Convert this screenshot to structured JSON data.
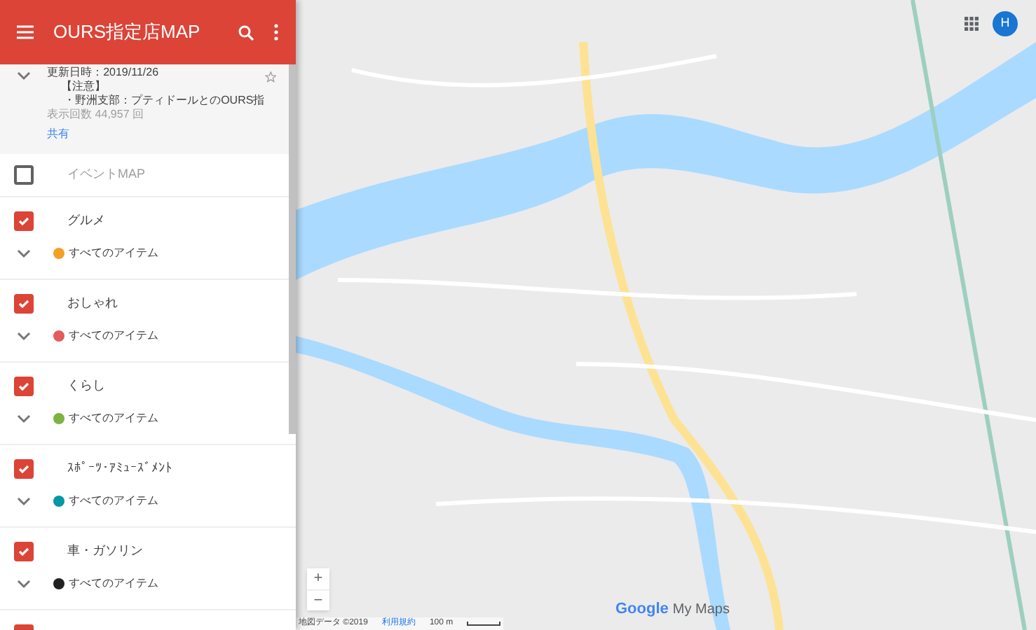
{
  "header": {
    "title": "OURS指定店MAP"
  },
  "info": {
    "expanded": true,
    "lines": [
      "更新日時：2019/11/26",
      "【注意】",
      "・野洲支部：プティドールとのOURS指"
    ],
    "views": "表示回数 44,957 回",
    "share": "共有",
    "starred": false
  },
  "layers": [
    {
      "name": "イベントMAP",
      "checked": false
    },
    {
      "name": "グルメ",
      "checked": true,
      "items_label": "すべてのアイテム",
      "color": "#f4a025"
    },
    {
      "name": "おしゃれ",
      "checked": true,
      "items_label": "すべてのアイテム",
      "color": "#e65a5a"
    },
    {
      "name": "くらし",
      "checked": true,
      "items_label": "すべてのアイテム",
      "color": "#7cb342"
    },
    {
      "name": "ｽﾎﾟｰﾂ･ｱﾐｭｰｽﾞﾒﾝﾄ",
      "checked": true,
      "items_label": "すべてのアイテム",
      "color": "#0097a7"
    },
    {
      "name": "車・ガソリン",
      "checked": true,
      "items_label": "すべてのアイテム",
      "color": "#212121"
    },
    {
      "checked": true
    }
  ],
  "map": {
    "avatar": "H",
    "zoom_in": "+",
    "zoom_out": "−",
    "logo": "Google",
    "logo_suffix": "My Maps",
    "attribution": "地図データ ©2019",
    "terms": "利用規約",
    "scale": "100 m"
  }
}
